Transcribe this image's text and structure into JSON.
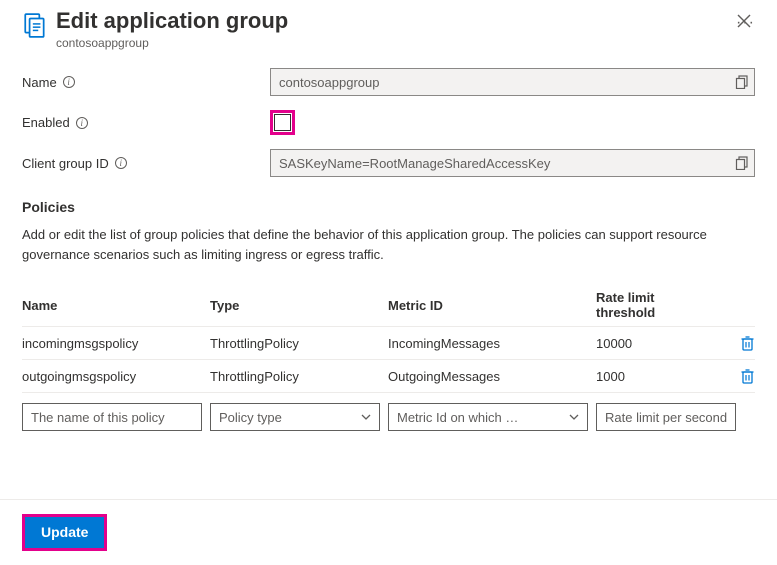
{
  "header": {
    "title": "Edit application group",
    "subtitle": "contosoappgroup"
  },
  "form": {
    "name_label": "Name",
    "name_value": "contosoappgroup",
    "enabled_label": "Enabled",
    "enabled_checked": false,
    "clientgroupid_label": "Client group ID",
    "clientgroupid_value": "SASKeyName=RootManageSharedAccessKey"
  },
  "policies": {
    "section_title": "Policies",
    "description": "Add or edit the list of group policies that define the behavior of this application group. The policies can support resource governance scenarios such as limiting ingress or egress traffic.",
    "columns": {
      "name": "Name",
      "type": "Type",
      "metric": "Metric ID",
      "rate": "Rate limit threshold"
    },
    "rows": [
      {
        "name": "incomingmsgspolicy",
        "type": "ThrottlingPolicy",
        "metric": "IncomingMessages",
        "rate": "10000"
      },
      {
        "name": "outgoingmsgspolicy",
        "type": "ThrottlingPolicy",
        "metric": "OutgoingMessages",
        "rate": "1000"
      }
    ],
    "inputs": {
      "name_placeholder": "The name of this policy",
      "type_placeholder": "Policy type",
      "metric_placeholder": "Metric Id on which …",
      "rate_placeholder": "Rate limit per second"
    }
  },
  "footer": {
    "update_label": "Update"
  }
}
